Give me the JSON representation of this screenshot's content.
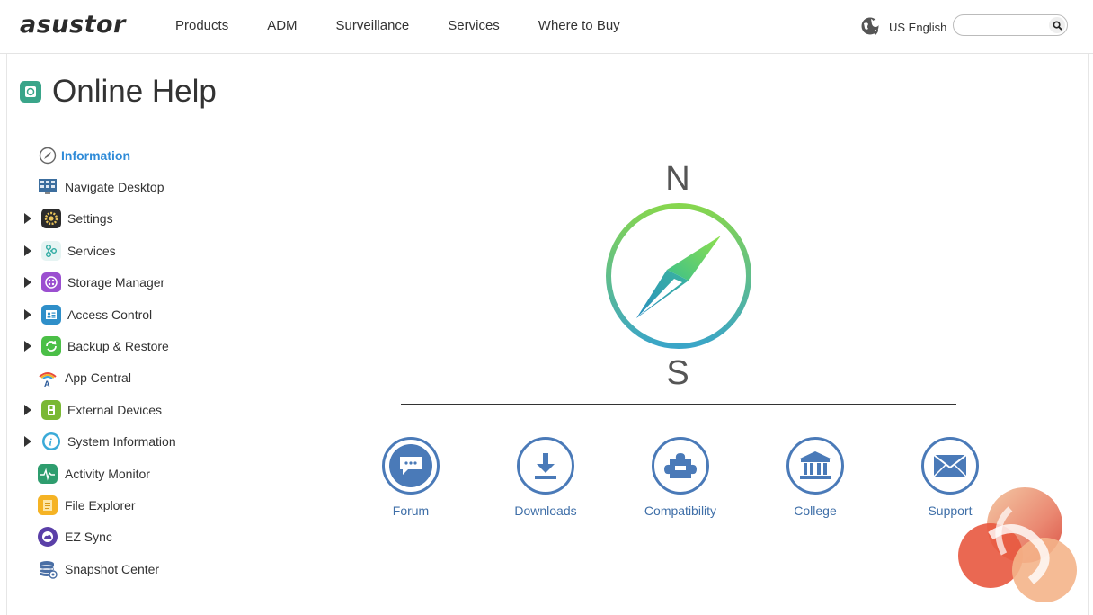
{
  "header": {
    "logo": "asustor",
    "nav": [
      "Products",
      "ADM",
      "Surveillance",
      "Services",
      "Where to Buy"
    ],
    "language": "US English",
    "search": {
      "value": "",
      "placeholder": ""
    }
  },
  "page": {
    "title": "Online Help"
  },
  "sidebar": {
    "items": [
      {
        "label": "Information",
        "active": true,
        "expandable": false,
        "icon": "compass-icon"
      },
      {
        "label": "Navigate Desktop",
        "expandable": false,
        "icon": "desktop-icon"
      },
      {
        "label": "Settings",
        "expandable": true,
        "icon": "gear-icon"
      },
      {
        "label": "Services",
        "expandable": true,
        "icon": "services-icon"
      },
      {
        "label": "Storage Manager",
        "expandable": true,
        "icon": "storage-icon"
      },
      {
        "label": "Access Control",
        "expandable": true,
        "icon": "access-control-icon"
      },
      {
        "label": "Backup & Restore",
        "expandable": true,
        "icon": "backup-icon"
      },
      {
        "label": "App Central",
        "expandable": false,
        "icon": "app-central-icon"
      },
      {
        "label": "External Devices",
        "expandable": true,
        "icon": "external-devices-icon"
      },
      {
        "label": "System Information",
        "expandable": true,
        "icon": "info-icon"
      },
      {
        "label": "Activity Monitor",
        "expandable": false,
        "icon": "activity-monitor-icon"
      },
      {
        "label": "File Explorer",
        "expandable": false,
        "icon": "file-explorer-icon"
      },
      {
        "label": "EZ Sync",
        "expandable": false,
        "icon": "ez-sync-icon"
      },
      {
        "label": "Snapshot Center",
        "expandable": false,
        "icon": "snapshot-icon"
      }
    ]
  },
  "compass": {
    "north": "N",
    "south": "S"
  },
  "links": [
    {
      "label": "Forum",
      "icon": "chat-bubble-icon"
    },
    {
      "label": "Downloads",
      "icon": "download-icon"
    },
    {
      "label": "Compatibility",
      "icon": "puzzle-icon"
    },
    {
      "label": "College",
      "icon": "college-icon"
    },
    {
      "label": "Support",
      "icon": "mail-icon"
    }
  ],
  "colors": {
    "active_link": "#2f8bd8",
    "link_blue": "#4a7ab8",
    "title_icon": "#3aa58a"
  }
}
